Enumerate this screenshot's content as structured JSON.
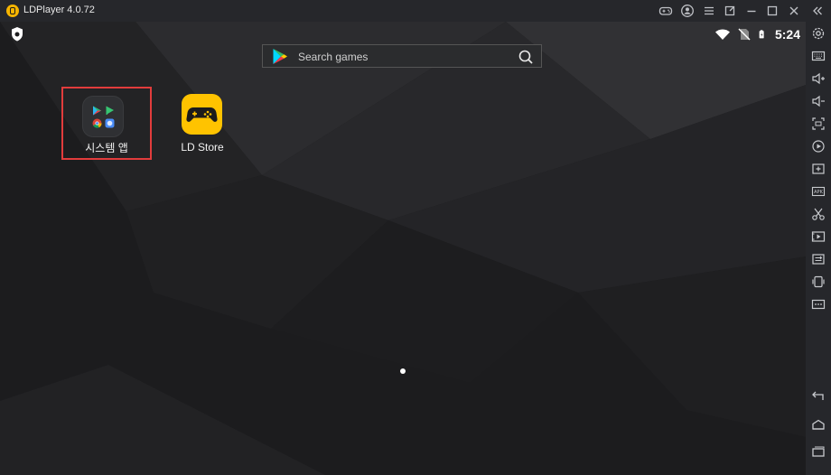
{
  "window": {
    "title": "LDPlayer 4.0.72"
  },
  "title_controls": [
    {
      "name": "gamepad-icon"
    },
    {
      "name": "account-icon"
    },
    {
      "name": "menu-icon"
    },
    {
      "name": "popout-icon"
    },
    {
      "name": "minimize-icon"
    },
    {
      "name": "maximize-icon"
    },
    {
      "name": "close-icon"
    },
    {
      "name": "collapse-sidebar-icon"
    }
  ],
  "status_bar": {
    "time": "5:24"
  },
  "search": {
    "placeholder": "Search games"
  },
  "apps": [
    {
      "label": "시스템 앱",
      "icon": "system-apps-folder-icon",
      "highlighted": true
    },
    {
      "label": "LD Store",
      "icon": "ld-store-icon"
    }
  ],
  "colors": {
    "highlight_border": "#e23c3c",
    "ld_store_yellow": "#ffc300",
    "titlebar": "#26272b",
    "desktop": "#1e1e20"
  },
  "sidebar": {
    "top": [
      "settings-icon",
      "keyboard-icon",
      "volume-up-icon",
      "volume-down-icon",
      "fullscreen-icon",
      "record-icon",
      "add-app-icon",
      "apk-install-icon",
      "scissors-icon",
      "video-icon",
      "shared-folder-icon",
      "shake-icon",
      "more-icon"
    ],
    "bottom": [
      "back-icon",
      "home-icon",
      "recent-apps-icon"
    ]
  }
}
